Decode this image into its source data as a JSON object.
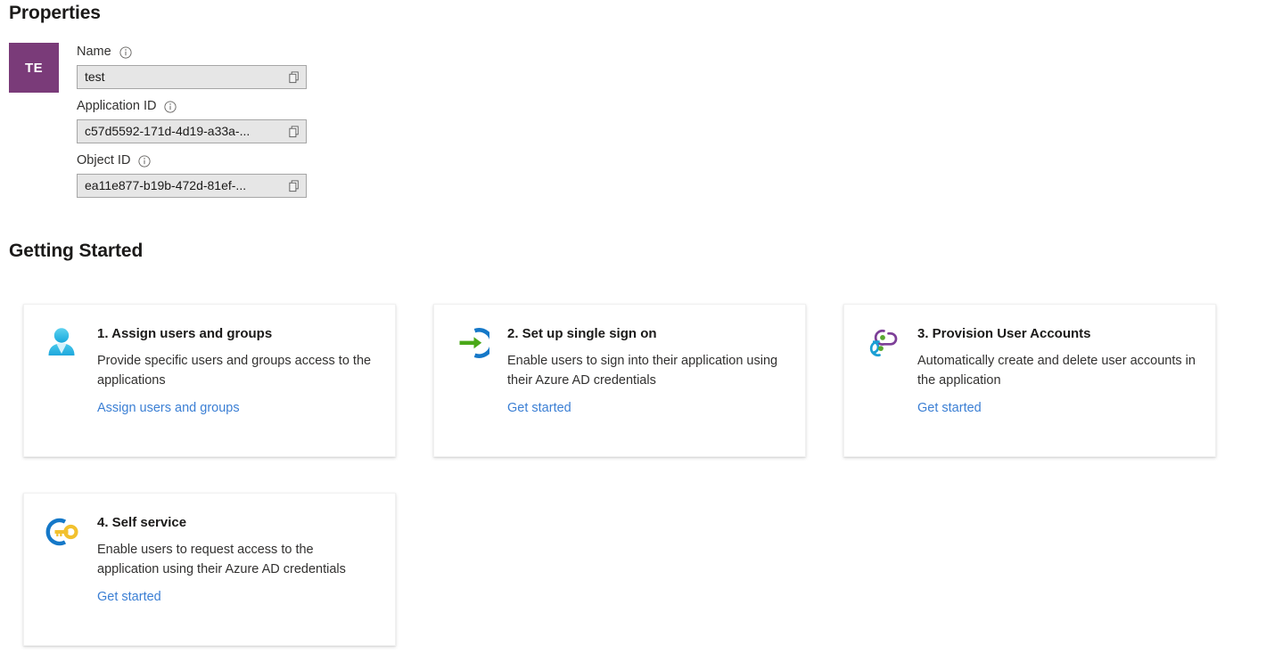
{
  "properties": {
    "section_title": "Properties",
    "avatar_initials": "TE",
    "avatar_color": "#7a3b79",
    "fields": [
      {
        "label": "Name",
        "value": "test",
        "info_icon": "info-icon",
        "copy_icon": "copy-icon"
      },
      {
        "label": "Application ID",
        "value": "c57d5592-171d-4d19-a33a-...",
        "info_icon": "info-icon",
        "copy_icon": "copy-icon"
      },
      {
        "label": "Object ID",
        "value": "ea11e877-b19b-472d-81ef-...",
        "info_icon": "info-icon",
        "copy_icon": "copy-icon"
      }
    ]
  },
  "getting_started": {
    "section_title": "Getting Started",
    "link_color": "#3b7fd4",
    "cards": [
      {
        "icon": "user-person-icon",
        "title": "1. Assign users and groups",
        "description": "Provide specific users and groups access to the applications",
        "link": "Assign users and groups"
      },
      {
        "icon": "single-sign-on-arrow-icon",
        "title": "2. Set up single sign on",
        "description": "Enable users to sign into their application using their Azure AD credentials",
        "link": "Get started"
      },
      {
        "icon": "provisioning-sync-icon",
        "title": "3. Provision User Accounts",
        "description": "Automatically create and delete user accounts in the application",
        "link": "Get started"
      },
      {
        "icon": "self-service-key-icon",
        "title": "4. Self service",
        "description": "Enable users to request access to the application using their Azure AD credentials",
        "link": "Get started"
      }
    ]
  }
}
